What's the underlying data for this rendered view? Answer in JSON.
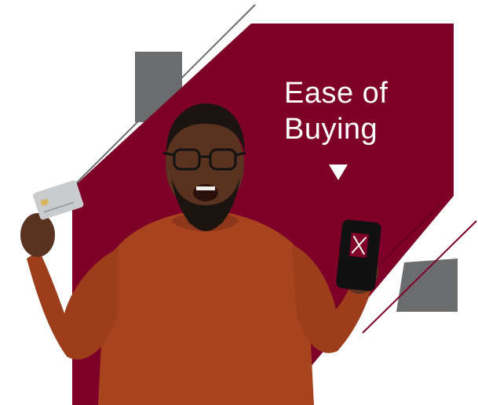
{
  "headline": {
    "line1": "Ease of",
    "line2": "Buying"
  },
  "colors": {
    "brand_maroon": "#7e0028",
    "accent_gray": "#6b6c6e",
    "background": "#ffffff",
    "sweater": "#a8431f",
    "skin": "#5a3320"
  },
  "icons": {
    "down_arrow": "down-triangle-icon",
    "card": "credit-card-icon",
    "phone": "smartphone-icon"
  }
}
